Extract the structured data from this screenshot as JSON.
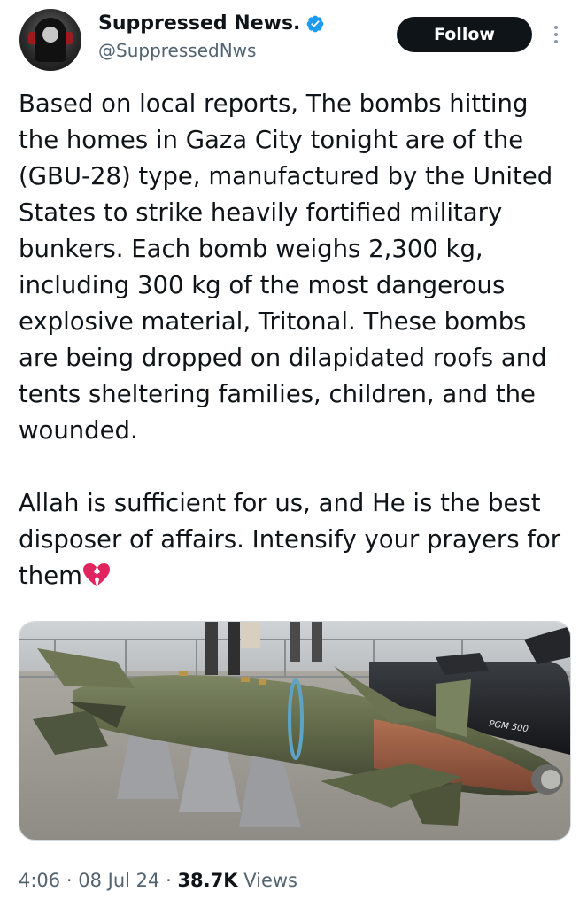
{
  "author": {
    "display_name": "Suppressed News.",
    "handle": "@SuppressedNws",
    "verified": true,
    "avatar_icon": "hooded-figure-avatar"
  },
  "actions": {
    "follow_label": "Follow",
    "more_icon": "more-vertical-icon"
  },
  "tweet": {
    "paragraph_1": "Based on local reports, The bombs hitting the homes in Gaza City tonight are of the (GBU-28) type, manufactured by the United States to strike heavily fortified military bunkers. Each bomb weighs 2,300 kg, including 300 kg of the most dangerous explosive material, Tritonal. These bombs are being dropped on dilapidated roofs and tents sheltering families, children, and the wounded.",
    "paragraph_2": "Allah is sufficient for us, and He is the best disposer of affairs. Intensify your prayers for them",
    "emoji": "broken-heart-icon"
  },
  "media": {
    "photo_label": "PGM 500"
  },
  "meta": {
    "time": "4:06",
    "separator": "·",
    "date": "08 Jul 24",
    "views_count": "38.7K",
    "views_label": "Views"
  },
  "colors": {
    "text": "#0f1419",
    "secondary": "#536471",
    "verified": "#1d9bf0",
    "heart": "#e0245e"
  }
}
